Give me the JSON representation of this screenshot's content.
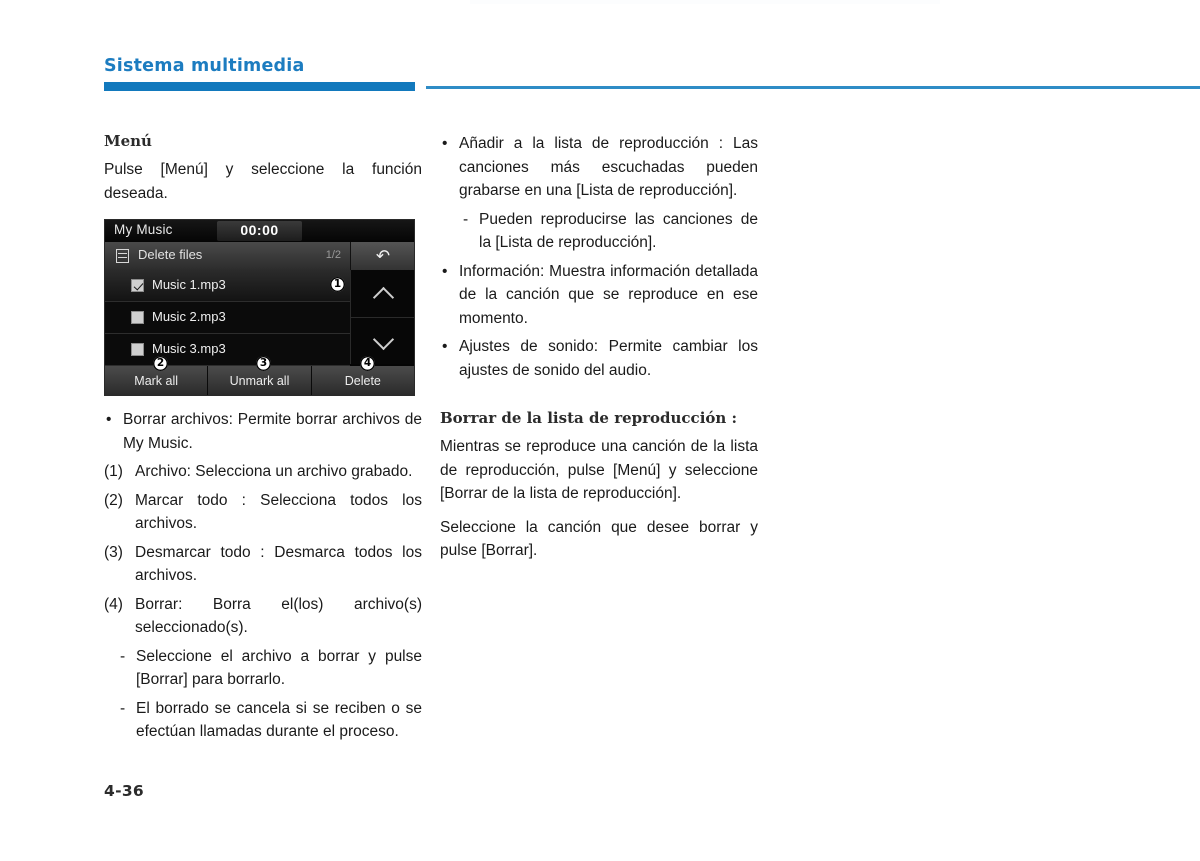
{
  "header": {
    "title": "Sistema multimedia",
    "accent_color": "#1279bd"
  },
  "footer": {
    "page_number": "4-36"
  },
  "left_column": {
    "menu_heading": "Menú",
    "menu_intro": "Pulse [Menú] y seleccione la función deseada.",
    "head_unit": {
      "source_label": "My Music",
      "time": "00:00",
      "subbar_title": "Delete files",
      "page_indicator": "1/2",
      "list_icon": "list-icon",
      "back_icon": "back-arrow-icon",
      "scroll_up_icon": "chevron-up-icon",
      "scroll_down_icon": "chevron-down-icon",
      "rows": [
        {
          "label": "Music 1.mp3",
          "checked": true,
          "selected": true
        },
        {
          "label": "Music 2.mp3",
          "checked": false,
          "selected": false
        },
        {
          "label": "Music 3.mp3",
          "checked": false,
          "selected": false
        }
      ],
      "softkeys": [
        {
          "label": "Mark all"
        },
        {
          "label": "Unmark all"
        },
        {
          "label": "Delete"
        }
      ],
      "callouts": [
        "1",
        "2",
        "3",
        "4"
      ]
    },
    "items": [
      {
        "mark": "•",
        "text": "Borrar archivos: Permite borrar archivos de My Music."
      },
      {
        "mark": "(1)",
        "text": "Archivo: Selecciona un archivo grabado."
      },
      {
        "mark": "(2)",
        "text": "Marcar todo : Selecciona todos los archivos."
      },
      {
        "mark": "(3)",
        "text": "Desmarcar todo : Desmarca todos los archivos."
      },
      {
        "mark": "(4)",
        "text": "Borrar: Borra el(los) archivo(s) seleccionado(s)."
      }
    ],
    "sub_items": [
      {
        "mark": "-",
        "text": "Seleccione el archivo a borrar y pulse [Borrar] para borrarlo."
      },
      {
        "mark": "-",
        "text": "El borrado se cancela si se reciben o se efectúan llamadas durante el proceso."
      }
    ]
  },
  "right_column": {
    "bullet_1": {
      "mark": "•",
      "text": "Añadir a la lista de reproducción : Las canciones más escuchadas pueden grabarse en una [Lista de reproducción]."
    },
    "bullet_1_sub": {
      "mark": "-",
      "text": "Pueden reproducirse las canciones de la [Lista de reproducción]."
    },
    "bullet_2": {
      "mark": "•",
      "text": "Información: Muestra información detallada de la canción que se reproduce en ese momento."
    },
    "bullet_3": {
      "mark": "•",
      "text": "Ajustes de sonido: Permite cambiar los ajustes de sonido del audio."
    },
    "section_heading": "Borrar de la lista de reproducción :",
    "paragraph_1": "Mientras se reproduce una canción de la lista de reproducción, pulse [Menú] y seleccione [Borrar de la lista de reproducción].",
    "paragraph_2": "Seleccione la canción que desee borrar y pulse [Borrar]."
  }
}
